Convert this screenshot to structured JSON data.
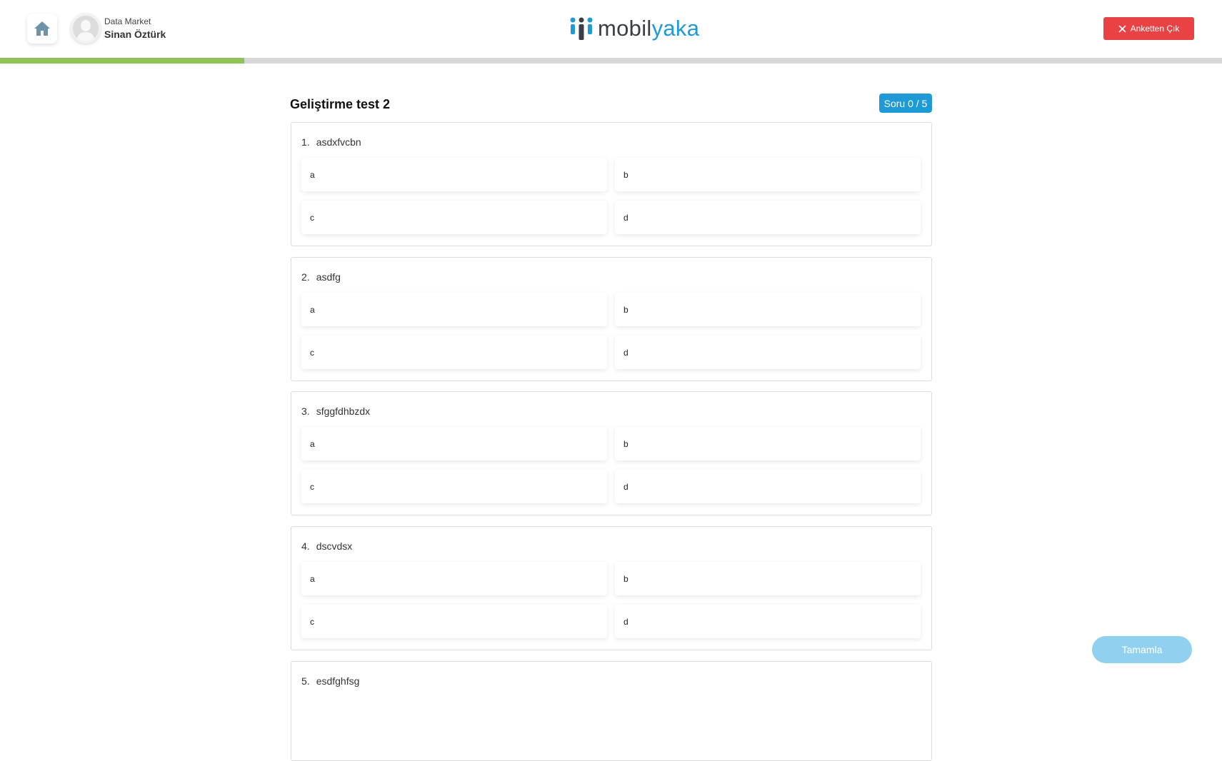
{
  "header": {
    "company": "Data Market",
    "user_name": "Sinan Öztürk",
    "logo": {
      "part1": "mobil",
      "part2": "yaka"
    },
    "exit_label": "Anketten Çık",
    "progress_fraction": 0.2
  },
  "survey": {
    "title": "Geliştirme test 2",
    "counter": "Soru 0 / 5",
    "questions": [
      {
        "number": "1.",
        "text": "asdxfvcbn",
        "options": [
          "a",
          "b",
          "c",
          "d"
        ]
      },
      {
        "number": "2.",
        "text": "asdfg",
        "options": [
          "a",
          "b",
          "c",
          "d"
        ]
      },
      {
        "number": "3.",
        "text": "sfggfdhbzdx",
        "options": [
          "a",
          "b",
          "c",
          "d"
        ]
      },
      {
        "number": "4.",
        "text": "dscvdsx",
        "options": [
          "a",
          "b",
          "c",
          "d"
        ]
      },
      {
        "number": "5.",
        "text": "esdfghfsg"
      }
    ]
  },
  "footer": {
    "complete_label": "Tamamla"
  },
  "colors": {
    "brand_blue": "#1e9ad6",
    "exit_red": "#ea4244",
    "progress_green": "#8fc35a",
    "complete_button": "#8fd1ee",
    "home_icon": "#6f93aa"
  },
  "icons": {
    "home": "home-icon",
    "avatar": "user-avatar-icon",
    "exit": "close-icon",
    "logo": "people-logo-icon"
  }
}
